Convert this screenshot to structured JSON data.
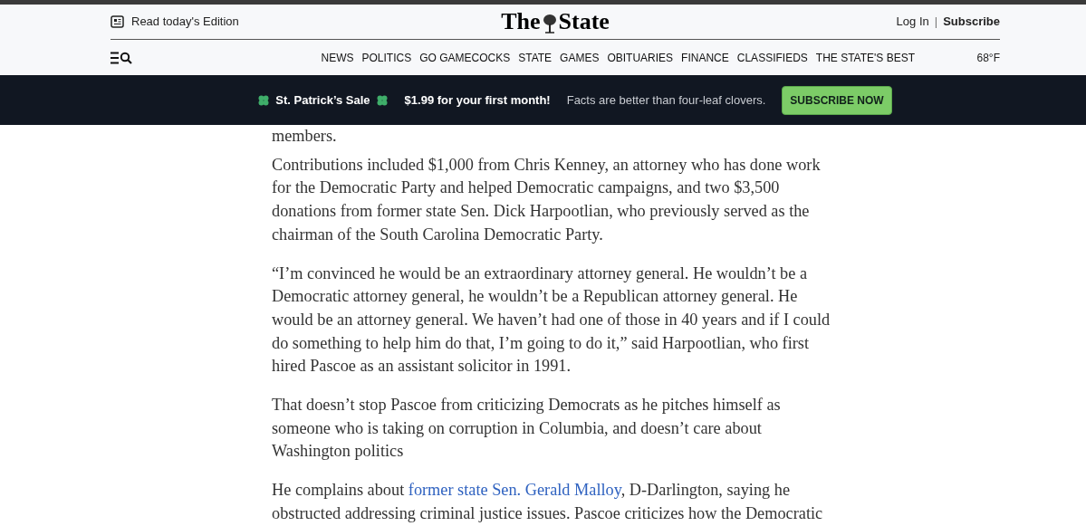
{
  "header": {
    "edition_link": "Read today's Edition",
    "logo": {
      "left": "The",
      "right": "State"
    },
    "login": "Log In",
    "separator": "|",
    "subscribe": "Subscribe",
    "temperature": "68°F"
  },
  "nav": [
    {
      "label": "NEWS"
    },
    {
      "label": "POLITICS"
    },
    {
      "label": "GO GAMECOCKS"
    },
    {
      "label": "STATE"
    },
    {
      "label": "GAMES"
    },
    {
      "label": "OBITUARIES"
    },
    {
      "label": "FINANCE"
    },
    {
      "label": "CLASSIFIEDS"
    },
    {
      "label": "THE STATE'S BEST"
    }
  ],
  "banner": {
    "sale": "St. Patrick’s Sale",
    "offer": "$1.99 for your first month!",
    "tagline": "Facts are better than four-leaf clovers.",
    "button": "SUBSCRIBE NOW"
  },
  "article": {
    "cut_top": "members.",
    "paragraphs": [
      {
        "text": "Contributions included $1,000 from Chris Kenney, an attorney who has done work for the Democratic Party and helped Democratic campaigns, and two $3,500 donations from former state Sen. Dick Harpootlian, who previously served as the chairman of the South Carolina Democratic Party."
      },
      {
        "text": "“I’m convinced he would be an extraordinary attorney general. He wouldn’t be a Democratic attorney general, he wouldn’t be a Republican attorney general. He would be an attorney general. We haven’t had one of those in 40 years and if I could do something to help him do that, I’m going to do it,” said Harpootlian, who first hired Pascoe as an assistant solicitor in 1991."
      },
      {
        "text": "That doesn’t stop Pascoe from criticizing Democrats as he pitches himself as someone who is taking on corruption in Columbia, and doesn’t care about Washington politics"
      },
      {
        "text": "He complains about ",
        "link": "former state Sen. Gerald Malloy",
        "after": ", D-Darlington, saying he obstructed addressing criminal justice issues. Pascoe criticizes how the Democratic"
      }
    ]
  }
}
